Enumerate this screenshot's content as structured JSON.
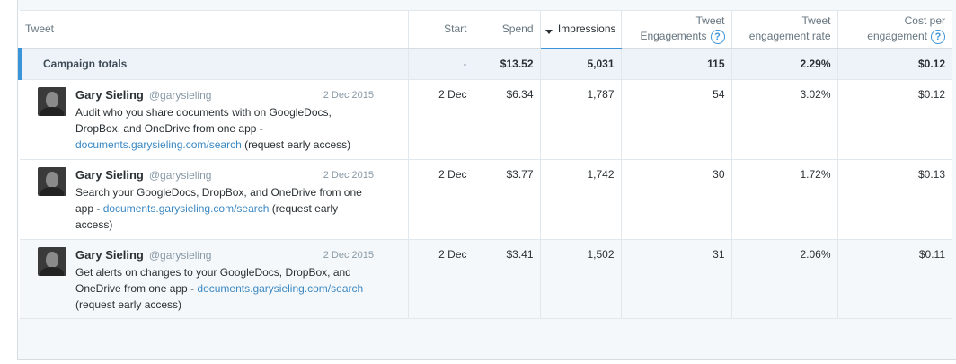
{
  "columns": {
    "tweet": "Tweet",
    "start": "Start",
    "spend": "Spend",
    "impressions": "Impressions",
    "engagements_l1": "Tweet",
    "engagements_l2": "Engagements",
    "rate_l1": "Tweet",
    "rate_l2": "engagement rate",
    "cost_l1": "Cost per",
    "cost_l2": "engagement",
    "help_glyph": "?"
  },
  "totals": {
    "label": "Campaign totals",
    "start": "-",
    "spend": "$13.52",
    "impressions": "5,031",
    "engagements": "115",
    "rate": "2.29%",
    "cost": "$0.12"
  },
  "tweets": [
    {
      "name": "Gary Sieling",
      "handle": "@garysieling",
      "date": "2 Dec 2015",
      "text_before": "Audit who you share documents with on GoogleDocs, DropBox, and OneDrive from one app - ",
      "link": "documents.garysieling.com/search",
      "text_after": " (request early access)",
      "start": "2 Dec",
      "spend": "$6.34",
      "impressions": "1,787",
      "engagements": "54",
      "rate": "3.02%",
      "cost": "$0.12"
    },
    {
      "name": "Gary Sieling",
      "handle": "@garysieling",
      "date": "2 Dec 2015",
      "text_before": "Search your GoogleDocs, DropBox, and OneDrive from one app - ",
      "link": "documents.garysieling.com/search",
      "text_after": " (request early access)",
      "start": "2 Dec",
      "spend": "$3.77",
      "impressions": "1,742",
      "engagements": "30",
      "rate": "1.72%",
      "cost": "$0.13"
    },
    {
      "name": "Gary Sieling",
      "handle": "@garysieling",
      "date": "2 Dec 2015",
      "text_before": "Get alerts on changes to your GoogleDocs, DropBox, and OneDrive from one app - ",
      "link": "documents.garysieling.com/search",
      "text_after": " (request early access)",
      "start": "2 Dec",
      "spend": "$3.41",
      "impressions": "1,502",
      "engagements": "31",
      "rate": "2.06%",
      "cost": "$0.11"
    }
  ],
  "colors": {
    "accent": "#3b94d9",
    "link": "#3b88c3",
    "totals_bg": "#edf3f8"
  },
  "icons": {
    "help": "help-circle-icon",
    "sort": "sort-desc-icon"
  }
}
